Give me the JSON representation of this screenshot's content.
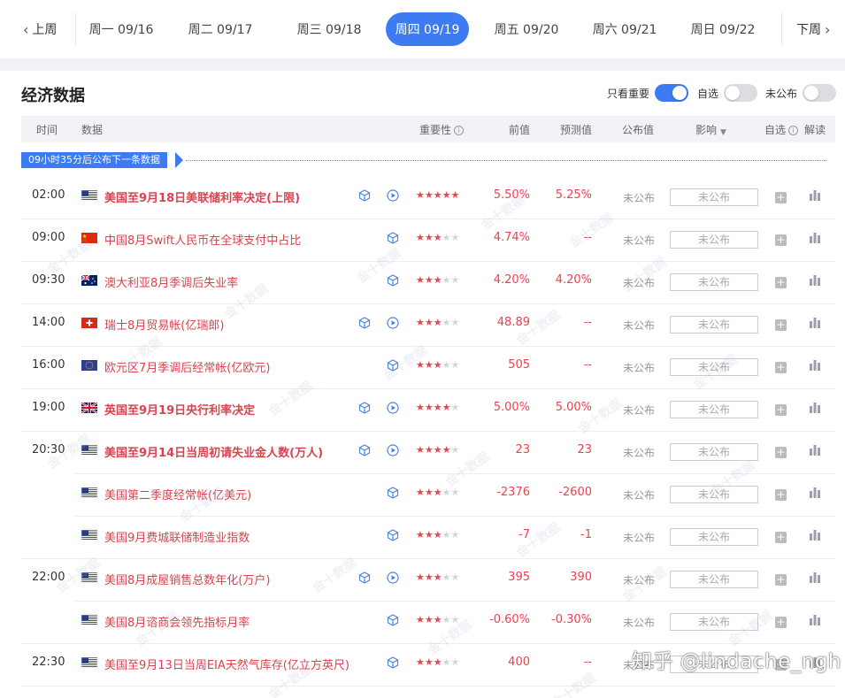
{
  "datebar": {
    "prev_label": "上周",
    "next_label": "下周",
    "days": [
      {
        "label": "周一 09/16",
        "active": false
      },
      {
        "label": "周二 09/17",
        "active": false
      },
      {
        "label": "周三 09/18",
        "active": false
      },
      {
        "label": "周四 09/19",
        "active": true
      },
      {
        "label": "周五 09/20",
        "active": false
      },
      {
        "label": "周六 09/21",
        "active": false
      },
      {
        "label": "周日 09/22",
        "active": false
      }
    ]
  },
  "section": {
    "title": "经济数据",
    "toggles": [
      {
        "label": "只看重要",
        "on": true
      },
      {
        "label": "自选",
        "on": false
      },
      {
        "label": "未公布",
        "on": false
      }
    ]
  },
  "table": {
    "headers": {
      "time": "时间",
      "data": "数据",
      "importance": "重要性",
      "previous": "前值",
      "forecast": "预测值",
      "actual": "公布值",
      "impact": "影响",
      "favorite": "自选",
      "interpret": "解读"
    },
    "countdown": "09小时35分后公布下一条数据",
    "rows": [
      {
        "time": "02:00",
        "flag": "us",
        "name": "美国至9月18日美联储利率决定(上限)",
        "bold": true,
        "has_video": true,
        "stars": 5,
        "previous": "5.50%",
        "forecast": "5.25%",
        "actual": "未公布",
        "impact": "未公布"
      },
      {
        "time": "09:00",
        "flag": "cn",
        "name": "中国8月Swift人民币在全球支付中占比",
        "bold": false,
        "has_video": false,
        "stars": 3,
        "previous": "4.74%",
        "forecast": "--",
        "actual": "未公布",
        "impact": "未公布"
      },
      {
        "time": "09:30",
        "flag": "au",
        "name": "澳大利亚8月季调后失业率",
        "bold": false,
        "has_video": false,
        "stars": 3,
        "previous": "4.20%",
        "forecast": "4.20%",
        "actual": "未公布",
        "impact": "未公布"
      },
      {
        "time": "14:00",
        "flag": "ch",
        "name": "瑞士8月贸易帐(亿瑞郎)",
        "bold": false,
        "has_video": true,
        "stars": 3,
        "previous": "48.89",
        "forecast": "--",
        "actual": "未公布",
        "impact": "未公布"
      },
      {
        "time": "16:00",
        "flag": "eu",
        "name": "欧元区7月季调后经常帐(亿欧元)",
        "bold": false,
        "has_video": false,
        "stars": 3,
        "previous": "505",
        "forecast": "--",
        "actual": "未公布",
        "impact": "未公布"
      },
      {
        "time": "19:00",
        "flag": "uk",
        "name": "英国至9月19日央行利率决定",
        "bold": true,
        "has_video": true,
        "stars": 4,
        "previous": "5.00%",
        "forecast": "5.00%",
        "actual": "未公布",
        "impact": "未公布"
      },
      {
        "time": "20:30",
        "flag": "us",
        "name": "美国至9月14日当周初请失业金人数(万人)",
        "bold": true,
        "has_video": true,
        "stars": 4,
        "previous": "23",
        "forecast": "23",
        "actual": "未公布",
        "impact": "未公布"
      },
      {
        "time": "",
        "flag": "us",
        "name": "美国第二季度经常帐(亿美元)",
        "bold": false,
        "has_video": false,
        "stars": 3,
        "previous": "-2376",
        "forecast": "-2600",
        "actual": "未公布",
        "impact": "未公布"
      },
      {
        "time": "",
        "flag": "us",
        "name": "美国9月费城联储制造业指数",
        "bold": false,
        "has_video": false,
        "stars": 3,
        "previous": "-7",
        "forecast": "-1",
        "actual": "未公布",
        "impact": "未公布"
      },
      {
        "time": "22:00",
        "flag": "us",
        "name": "美国8月成屋销售总数年化(万户)",
        "bold": false,
        "has_video": true,
        "stars": 3,
        "previous": "395",
        "forecast": "390",
        "actual": "未公布",
        "impact": "未公布"
      },
      {
        "time": "",
        "flag": "us",
        "name": "美国8月谘商会领先指标月率",
        "bold": false,
        "has_video": false,
        "stars": 3,
        "previous": "-0.60%",
        "forecast": "-0.30%",
        "actual": "未公布",
        "impact": "未公布"
      },
      {
        "time": "22:30",
        "flag": "us",
        "name": "美国至9月13日当周EIA天然气库存(亿立方英尺)",
        "bold": false,
        "has_video": false,
        "stars": 3,
        "previous": "400",
        "forecast": "--",
        "actual": "未公布",
        "impact": "未公布"
      }
    ]
  },
  "overlay": {
    "credit": "知乎 @lindache_ngh",
    "watermark": "金十数据"
  },
  "colors": {
    "accent": "#3d7bf0",
    "value_red": "#e8444f",
    "name_red": "#d9434f",
    "muted": "#999999"
  },
  "icons": {
    "prev": "chevron-left-icon",
    "next": "chevron-right-icon",
    "detail": "cube-icon",
    "video": "play-circle-icon",
    "add": "plus-icon",
    "chart": "bar-chart-icon",
    "info": "info-icon",
    "sort": "caret-down-icon"
  }
}
